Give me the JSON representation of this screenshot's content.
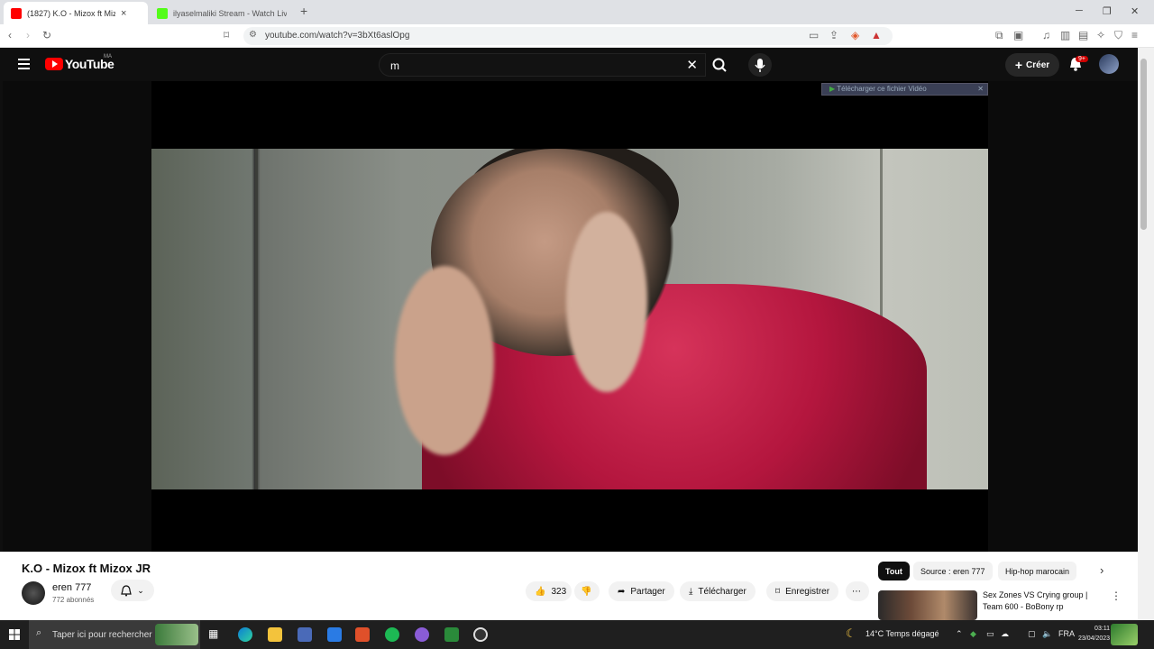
{
  "browser": {
    "tabs": [
      {
        "title": "(1827) K.O - Mizox ft Mizox JR",
        "active": true
      },
      {
        "title": "ilyaselmaliki Stream - Watch Live on",
        "active": false
      }
    ],
    "url": "youtube.com/watch?v=3bXt6aslOpg"
  },
  "youtube": {
    "logo_text": "YouTube",
    "country_code": "MA",
    "search_value": "m",
    "create_label": "Créer",
    "notification_badge": "9+",
    "download_overlay": "Télécharger ce fichier Vidéo"
  },
  "video": {
    "title": "K.O - Mizox ft Mizox JR",
    "channel": "eren 777",
    "subscribers": "772 abonnés",
    "likes": "323",
    "share_label": "Partager",
    "download_label": "Télécharger",
    "save_label": "Enregistrer"
  },
  "chips": [
    "Tout",
    "Source : eren 777",
    "Hip-hop marocain"
  ],
  "recommendation": {
    "title": "Sex Zones VS Crying group | Team 600 - BoBony rp"
  },
  "taskbar": {
    "search_placeholder": "Taper ici pour rechercher",
    "weather": "14°C  Temps dégagé",
    "lang": "FRA",
    "time": "03:11",
    "date": "23/04/2023"
  },
  "colors": {
    "yt_red": "#ff0000",
    "bg_dark": "#0f0f0f",
    "badge": "#cc0000"
  }
}
